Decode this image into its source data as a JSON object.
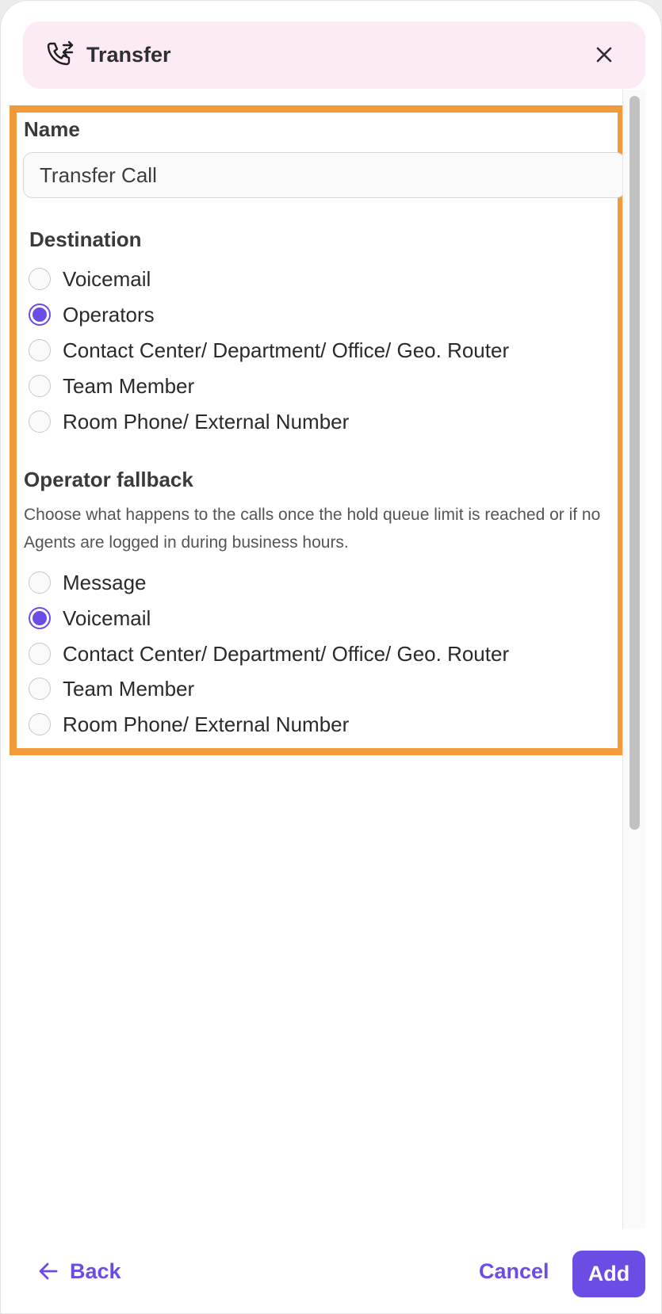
{
  "header": {
    "title": "Transfer",
    "icon": "phone-transfer-icon",
    "close_icon": "close-icon"
  },
  "form": {
    "name_label": "Name",
    "name_value": "Transfer Call",
    "destination": {
      "title": "Destination",
      "selected": "Operators",
      "options": [
        "Voicemail",
        "Operators",
        "Contact Center/ Department/ Office/ Geo. Router",
        "Team Member",
        "Room Phone/ External Number"
      ]
    },
    "fallback": {
      "title": "Operator fallback",
      "description": "Choose what happens to the calls once the hold queue limit is reached or if no Agents are logged in during business hours.",
      "selected": "Voicemail",
      "options": [
        "Message",
        "Voicemail",
        "Contact Center/ Department/ Office/ Geo. Router",
        "Team Member",
        "Room Phone/ External Number"
      ]
    }
  },
  "footer": {
    "back_label": "Back",
    "cancel_label": "Cancel",
    "add_label": "Add"
  },
  "colors": {
    "accent": "#6b4de6",
    "header_bg": "#fcebf4",
    "highlight_border": "#f39b3a"
  }
}
